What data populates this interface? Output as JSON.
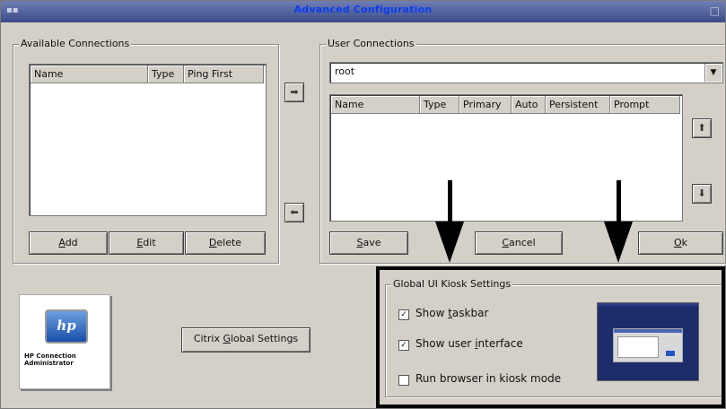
{
  "window": {
    "title": "Advanced Configuration"
  },
  "available": {
    "legend": "Available Connections",
    "columns": [
      "Name",
      "Type",
      "Ping First"
    ],
    "rows": [],
    "add_prefix": "",
    "add_mnemonic": "A",
    "add_rest": "dd",
    "edit_prefix": "",
    "edit_mnemonic": "E",
    "edit_rest": "dit",
    "delete_prefix": "",
    "delete_mnemonic": "D",
    "delete_rest": "elete"
  },
  "user": {
    "legend": "User Connections",
    "selected_user": "root",
    "columns": [
      "Name",
      "Type",
      "Primary",
      "Auto",
      "Persistent",
      "Prompt"
    ],
    "rows": [],
    "save_prefix": "",
    "save_mnemonic": "S",
    "save_rest": "ave",
    "cancel_prefix": "",
    "cancel_mnemonic": "C",
    "cancel_rest": "ancel",
    "ok_prefix": "",
    "ok_mnemonic": "O",
    "ok_rest": "k"
  },
  "logo": {
    "emblem": "hp",
    "caption_line1": "HP Connection",
    "caption_line2": "Administrator"
  },
  "citrix": {
    "prefix": "Citrix ",
    "mnemonic": "G",
    "rest": "lobal Settings"
  },
  "kiosk": {
    "legend": "Global UI Kiosk Settings",
    "show_taskbar": {
      "prefix": "Show ",
      "mnemonic": "t",
      "rest": "askbar",
      "checked": true
    },
    "show_ui": {
      "prefix": "Show user ",
      "mnemonic": "i",
      "rest": "nterface",
      "checked": true
    },
    "kiosk_mode": {
      "label": "Run browser in kiosk mode",
      "checked": false
    }
  },
  "icons": {
    "move_right": "arrow-right-icon",
    "move_left": "arrow-left-icon",
    "move_up": "arrow-up-icon",
    "move_down": "arrow-down-icon"
  },
  "glyphs": {
    "check": "✓",
    "right": "➡",
    "left": "⬅",
    "up": "⬆",
    "down": "⬇",
    "drop": "▼"
  }
}
